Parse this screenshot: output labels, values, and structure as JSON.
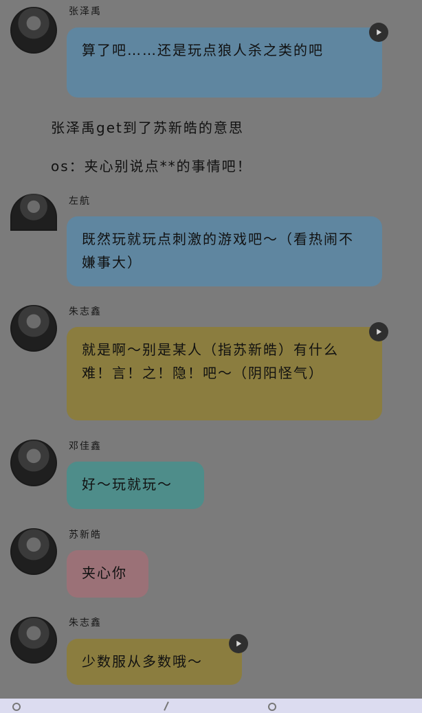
{
  "chat": {
    "messages": [
      {
        "name": "张泽禹",
        "text": "算了吧……还是玩点狼人杀之类的吧",
        "color": "#5f86a0",
        "has_play": true
      },
      {
        "name": "左航",
        "text": "既然玩就玩点刺激的游戏吧～（看热闹不嫌事大）",
        "color": "#5f86a0",
        "has_play": false
      },
      {
        "name": "朱志鑫",
        "text": "就是啊～别是某人（指苏新皓）有什么难！言！之！隐！吧～（阴阳怪气）",
        "color": "#8b7d3f",
        "has_play": true
      },
      {
        "name": "邓佳鑫",
        "text": "好～玩就玩～",
        "color": "#4e8d8a",
        "has_play": false
      },
      {
        "name": "苏新皓",
        "text": "夹心你",
        "color": "#9b7177",
        "has_play": false
      },
      {
        "name": "朱志鑫",
        "text": "少数服从多数哦～",
        "color": "#8b7d3f",
        "has_play": true
      }
    ],
    "narration": [
      "张泽禹get到了苏新皓的意思",
      "os：夹心别说点**的事情吧！"
    ]
  },
  "icons": {
    "play": "play-icon",
    "avatar": "avatar-image"
  }
}
